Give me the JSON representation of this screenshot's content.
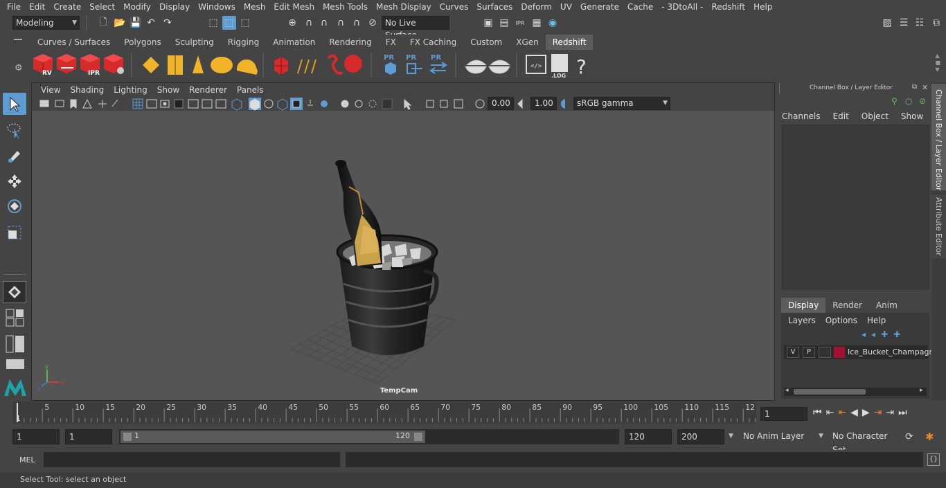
{
  "menu": [
    "File",
    "Edit",
    "Create",
    "Select",
    "Modify",
    "Display",
    "Windows",
    "Mesh",
    "Edit Mesh",
    "Mesh Tools",
    "Mesh Display",
    "Curves",
    "Surfaces",
    "Deform",
    "UV",
    "Generate",
    "Cache",
    "- 3DtoAll -",
    "Redshift",
    "Help"
  ],
  "status_line": {
    "mode": "Modeling",
    "live_surface": "No Live Surface"
  },
  "shelf": {
    "tabs": [
      "Curves / Surfaces",
      "Polygons",
      "Sculpting",
      "Rigging",
      "Animation",
      "Rendering",
      "FX",
      "FX Caching",
      "Custom",
      "XGen",
      "Redshift"
    ],
    "active_tab": "Redshift",
    "icon_labels": {
      "rv": "RV",
      "ipr": "IPR",
      "pr": "PR",
      "log": ".LOG",
      "help": "?"
    }
  },
  "panel": {
    "menu": [
      "View",
      "Shading",
      "Lighting",
      "Show",
      "Renderer",
      "Panels"
    ],
    "exposure": "0.00",
    "gamma": "1.00",
    "color_space": "sRGB gamma",
    "camera_label": "TempCam"
  },
  "channel_box": {
    "title": "Channel Box / Layer Editor",
    "menu": [
      "Channels",
      "Edit",
      "Object",
      "Show"
    ],
    "layer_tabs": [
      "Display",
      "Render",
      "Anim"
    ],
    "active_layer_tab": "Display",
    "layer_menu": [
      "Layers",
      "Options",
      "Help"
    ],
    "layer": {
      "v": "V",
      "p": "P",
      "name": "Ice_Bucket_Champagn",
      "color": "#a3122e"
    }
  },
  "side_tabs": [
    "Channel Box / Layer Editor",
    "Attribute Editor"
  ],
  "timeline": {
    "ticks": [
      "5",
      "10",
      "15",
      "20",
      "25",
      "30",
      "35",
      "40",
      "45",
      "50",
      "55",
      "60",
      "65",
      "70",
      "75",
      "80",
      "85",
      "90",
      "95",
      "100",
      "105",
      "110",
      "115",
      "12"
    ],
    "start_marker": "1",
    "current_frame": "1"
  },
  "range": {
    "start": "1",
    "playback_start": "1",
    "slider_start": "1",
    "slider_end": "120",
    "playback_end": "120",
    "end": "200",
    "anim_layer": "No Anim Layer",
    "character_set": "No Character Set"
  },
  "command_line": {
    "label": "MEL"
  },
  "help_line": "Select Tool: select an object",
  "colors": {
    "accent": "#5e9cd3",
    "redshift": "#d62b2b",
    "layer": "#a3122e"
  }
}
